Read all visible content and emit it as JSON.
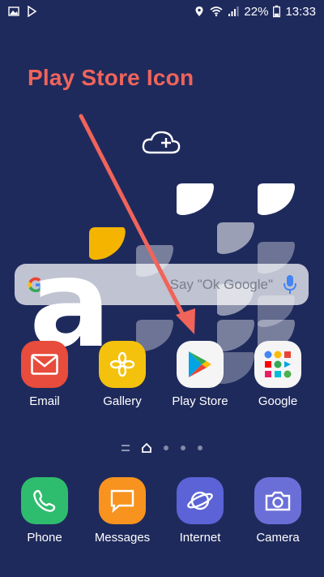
{
  "status_bar": {
    "battery": "22%",
    "time": "13:33",
    "icons": [
      "image-icon",
      "play-store-small-icon",
      "location-icon",
      "wifi-icon",
      "signal-icon",
      "battery-icon"
    ]
  },
  "annotation": {
    "title": "Play Store Icon",
    "color": "#f0645a"
  },
  "search": {
    "hint": "Say \"Ok Google\""
  },
  "overlay_letter": "a",
  "apps_row1": [
    {
      "label": "Email",
      "icon": "email-icon",
      "bg": "#e74c3c"
    },
    {
      "label": "Gallery",
      "icon": "gallery-icon",
      "bg": "#f4c20d"
    },
    {
      "label": "Play Store",
      "icon": "play-store-icon",
      "bg": "#f5f5f5"
    },
    {
      "label": "Google",
      "icon": "google-folder-icon",
      "bg": "#f5f5f5"
    }
  ],
  "dock": [
    {
      "label": "Phone",
      "icon": "phone-icon",
      "bg": "#2ebd6e"
    },
    {
      "label": "Messages",
      "icon": "messages-icon",
      "bg": "#f7931e"
    },
    {
      "label": "Internet",
      "icon": "internet-icon",
      "bg": "#5b63d6"
    },
    {
      "label": "Camera",
      "icon": "camera-icon",
      "bg": "#6a6fd8"
    }
  ],
  "colors": {
    "wallpaper": "#1f2a5c",
    "accent_yellow": "#f4b400"
  }
}
